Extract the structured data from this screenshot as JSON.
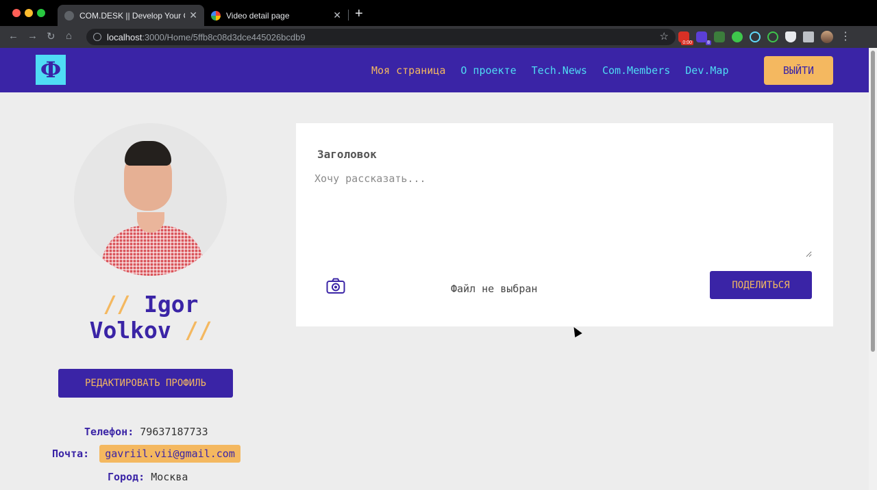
{
  "browser": {
    "tabs": [
      {
        "title": "COM.DESK || Develop Your Co",
        "close": "✕"
      },
      {
        "title": "Video detail page",
        "close": "✕"
      }
    ],
    "new_tab": "+",
    "url_host": "localhost",
    "url_path": ":3000/Home/5ffb8c08d3dce445026bcdb9",
    "nav_icons": {
      "back": "←",
      "forward": "→",
      "reload": "↻",
      "home": "⌂"
    },
    "star": "☆",
    "extension_badges": {
      "first": "0:00",
      "second": "8"
    }
  },
  "site": {
    "logo_glyph": "Ф",
    "nav": {
      "my_page": "Моя страница",
      "about": "О проекте",
      "tech_news": "Tech.News",
      "com_members": "Com.Members",
      "dev_map": "Dev.Map"
    },
    "logout_label": "ВЫЙТИ",
    "colors": {
      "brand": "#3a24a6",
      "accent": "#f4b860",
      "cyan": "#4fdcf4"
    }
  },
  "profile": {
    "name_prefix": "// ",
    "first_name": "Igor",
    "last_name": "Volkov",
    "name_suffix": " //",
    "edit_label": "РЕДАКТИРОВАТЬ ПРОФИЛЬ",
    "phone_label": "Телефон:",
    "phone": "79637187733",
    "email_label": "Почта:",
    "email": "gavriil.vii@gmail.com",
    "city_label": "Город:",
    "city": "Москва"
  },
  "post": {
    "title": "Заголовок",
    "placeholder": "Хочу рассказать...",
    "file_status": "Файл не выбран",
    "share_label": "ПОДЕЛИТЬСЯ"
  }
}
